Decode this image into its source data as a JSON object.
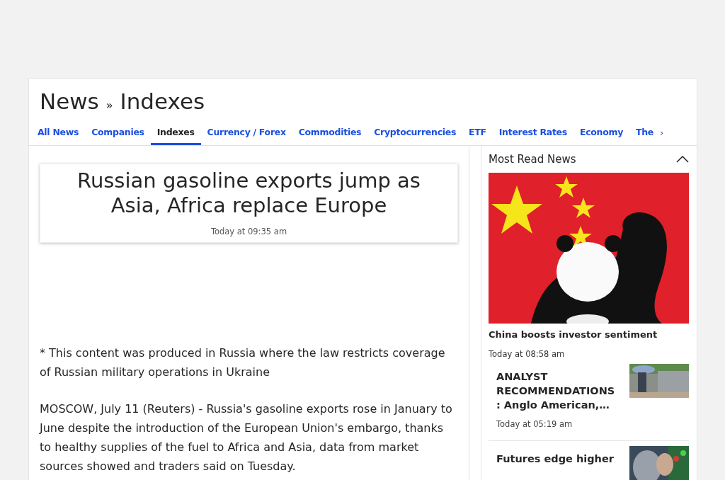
{
  "header": {
    "section": "News",
    "separator": "»",
    "subsection": "Indexes"
  },
  "tabs": [
    {
      "label": "All News",
      "selected": false
    },
    {
      "label": "Companies",
      "selected": false
    },
    {
      "label": "Indexes",
      "selected": true
    },
    {
      "label": "Currency / Forex",
      "selected": false
    },
    {
      "label": "Commodities",
      "selected": false
    },
    {
      "label": "Cryptocurrencies",
      "selected": false
    },
    {
      "label": "ETF",
      "selected": false
    },
    {
      "label": "Interest Rates",
      "selected": false
    },
    {
      "label": "Economy",
      "selected": false
    },
    {
      "label": "The",
      "selected": false
    }
  ],
  "tabs_more": "›",
  "article": {
    "headline": "Russian gasoline exports jump as Asia, Africa replace Europe",
    "time": "Today at 09:35 am",
    "paragraphs": [
      "* This content was produced in Russia where the law restricts coverage of Russian military operations in Ukraine",
      "MOSCOW, July 11 (Reuters) - Russia's gasoline exports rose in January to June despite the introduction of the European Union's embargo, thanks to healthy supplies of the fuel to Africa and Asia, data from market sources showed and traders said on Tuesday."
    ]
  },
  "most_read": {
    "title": "Most Read News",
    "expanded": true,
    "featured": {
      "kind": "picture",
      "title": "China boosts investor sentiment",
      "time": "Today at 08:58 am"
    },
    "items": [
      {
        "kind": "picture",
        "title": "ANALYST RECOMMENDATIONS: Anglo American,…",
        "time": "Today at 05:19 am"
      },
      {
        "kind": "picture",
        "title": "Futures edge higher"
      }
    ]
  }
}
